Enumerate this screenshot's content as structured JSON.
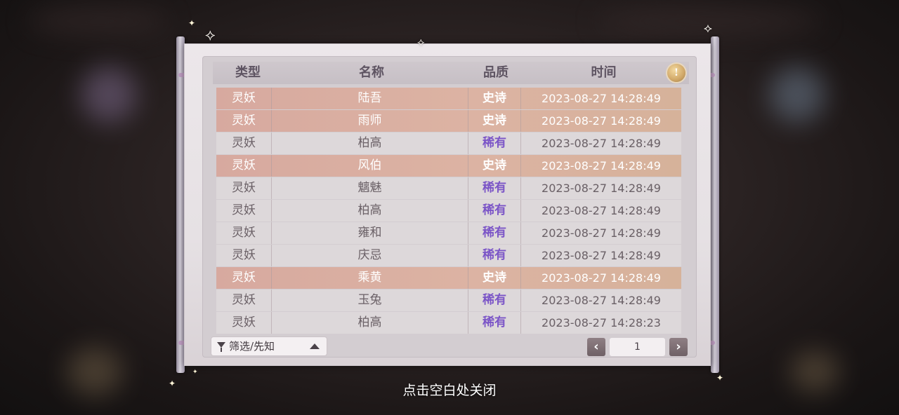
{
  "header": {
    "type": "类型",
    "name": "名称",
    "quality": "品质",
    "time": "时间"
  },
  "info_icon": "lightbulb-icon",
  "rows": [
    {
      "type": "灵妖",
      "name": "陆吾",
      "quality": "史诗",
      "time": "2023-08-27  14:28:49",
      "tier": "epic"
    },
    {
      "type": "灵妖",
      "name": "雨师",
      "quality": "史诗",
      "time": "2023-08-27  14:28:49",
      "tier": "epic"
    },
    {
      "type": "灵妖",
      "name": "柏高",
      "quality": "稀有",
      "time": "2023-08-27  14:28:49",
      "tier": "rare"
    },
    {
      "type": "灵妖",
      "name": "风伯",
      "quality": "史诗",
      "time": "2023-08-27  14:28:49",
      "tier": "epic"
    },
    {
      "type": "灵妖",
      "name": "魑魅",
      "quality": "稀有",
      "time": "2023-08-27  14:28:49",
      "tier": "rare"
    },
    {
      "type": "灵妖",
      "name": "柏高",
      "quality": "稀有",
      "time": "2023-08-27  14:28:49",
      "tier": "rare"
    },
    {
      "type": "灵妖",
      "name": "雍和",
      "quality": "稀有",
      "time": "2023-08-27  14:28:49",
      "tier": "rare"
    },
    {
      "type": "灵妖",
      "name": "庆忌",
      "quality": "稀有",
      "time": "2023-08-27  14:28:49",
      "tier": "rare"
    },
    {
      "type": "灵妖",
      "name": "乘黄",
      "quality": "史诗",
      "time": "2023-08-27  14:28:49",
      "tier": "epic"
    },
    {
      "type": "灵妖",
      "name": "玉兔",
      "quality": "稀有",
      "time": "2023-08-27  14:28:49",
      "tier": "rare"
    },
    {
      "type": "灵妖",
      "name": "柏高",
      "quality": "稀有",
      "time": "2023-08-27  14:28:23",
      "tier": "rare"
    }
  ],
  "filter": {
    "label": "筛选/先知",
    "icon": "funnel-icon",
    "arrow_icon": "triangle-up-icon"
  },
  "pagination": {
    "prev": "‹",
    "next": "›",
    "current_page": "1"
  },
  "close_hint": "点击空白处关闭",
  "colors": {
    "epic_row": "#d7a99f",
    "rare_row": "#ddd8da",
    "rare_text": "#7b55c7"
  }
}
